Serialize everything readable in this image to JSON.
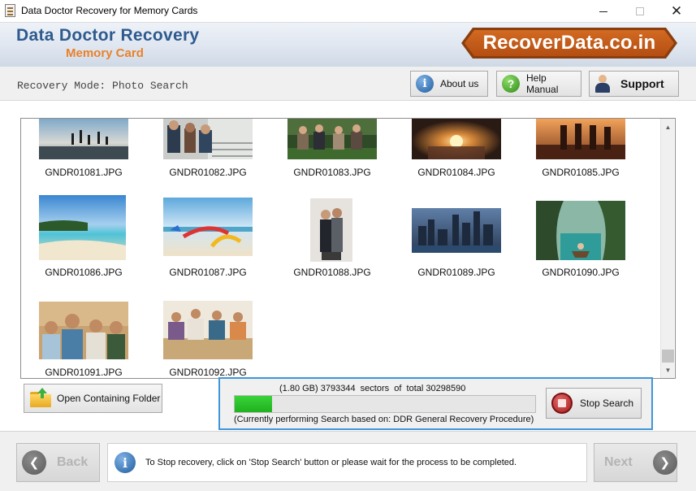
{
  "window": {
    "title": "Data Doctor Recovery for Memory Cards",
    "minimize_icon": "minimize-icon",
    "maximize_icon": "maximize-icon",
    "close_icon": "close-icon",
    "close_glyph": "✕"
  },
  "header": {
    "brand_title": "Data Doctor Recovery",
    "brand_subtitle": "Memory Card",
    "logo_text": "RecoverData.co.in"
  },
  "toolbar": {
    "mode_label": "Recovery Mode: Photo Search",
    "about_label": "About us",
    "help_label": "Help Manual",
    "support_label": "Support",
    "about_icon_glyph": "i",
    "help_icon_glyph": "?"
  },
  "gallery": {
    "files": [
      {
        "name": "GNDR01081.JPG",
        "scene": "beach-jumping-silhouettes"
      },
      {
        "name": "GNDR01082.JPG",
        "scene": "friends-sitting-on-steps"
      },
      {
        "name": "GNDR01083.JPG",
        "scene": "friends-in-park"
      },
      {
        "name": "GNDR01084.JPG",
        "scene": "hands-holding-lights"
      },
      {
        "name": "GNDR01085.JPG",
        "scene": "hikers-at-sunset"
      },
      {
        "name": "GNDR01086.JPG",
        "scene": "tropical-beach"
      },
      {
        "name": "GNDR01087.JPG",
        "scene": "kites-on-beach"
      },
      {
        "name": "GNDR01088.JPG",
        "scene": "couple-portrait"
      },
      {
        "name": "GNDR01089.JPG",
        "scene": "city-skyline-at-dusk"
      },
      {
        "name": "GNDR01090.JPG",
        "scene": "boat-in-lagoon"
      },
      {
        "name": "GNDR01091.JPG",
        "scene": "group-of-friends"
      },
      {
        "name": "GNDR01092.JPG",
        "scene": "friends-at-table"
      }
    ],
    "scroll_up_glyph": "▲",
    "scroll_down_glyph": "▼"
  },
  "actions": {
    "open_folder_label": "Open Containing Folder"
  },
  "progress": {
    "sectors_text": "(1.80 GB) 3793344  sectors  of  total 30298590",
    "fraction": 0.125,
    "procedure_text": "(Currently performing Search based on:  DDR General Recovery Procedure)",
    "stop_label": "Stop Search"
  },
  "footer": {
    "back_label": "Back",
    "next_label": "Next",
    "back_glyph": "❮",
    "next_glyph": "❯",
    "status_text": "To Stop recovery, click on 'Stop Search' button or please wait for the process to be completed.",
    "info_glyph": "i"
  },
  "colors": {
    "brand_blue": "#2f5a8e",
    "brand_orange": "#e8822a",
    "progress_green": "#2cc42c",
    "panel_highlight": "#3f96d8"
  }
}
